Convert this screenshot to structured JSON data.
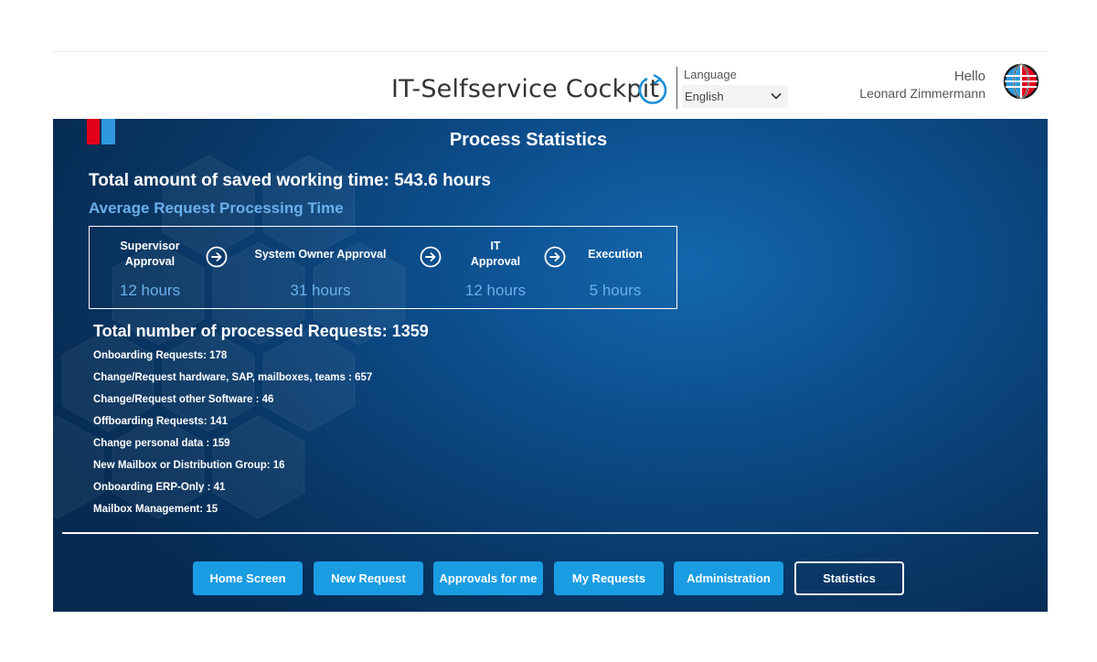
{
  "header": {
    "app_title": "IT-Selfservice Cockpit",
    "language_label": "Language",
    "language_value": "English",
    "greeting_hello": "Hello",
    "user_name": "Leonard Zimmermann"
  },
  "main": {
    "page_title": "Process Statistics",
    "saved_time": "Total amount of saved working time: 543.6 hours",
    "avg_title": "Average Request Processing Time",
    "steps": [
      {
        "label_line1": "Supervisor",
        "label_line2": "Approval",
        "value": "12 hours"
      },
      {
        "label_line1": "System Owner Approval",
        "label_line2": "",
        "value": "31 hours"
      },
      {
        "label_line1": "IT",
        "label_line2": "Approval",
        "value": "12 hours"
      },
      {
        "label_line1": "Execution",
        "label_line2": "",
        "value": "5 hours"
      }
    ],
    "total_requests": "Total number of processed Requests: 1359",
    "requests": [
      "Onboarding Requests: 178",
      "Change/Request hardware, SAP, mailboxes, teams : 657",
      "Change/Request other Software : 46",
      "Offboarding Requests: 141",
      "Change personal data : 159",
      "New Mailbox or Distribution Group: 16",
      "Onboarding ERP-Only : 41",
      "Mailbox Management: 15"
    ]
  },
  "nav": {
    "buttons": [
      {
        "label": "Home Screen",
        "active": false
      },
      {
        "label": "New Request",
        "active": false
      },
      {
        "label": "Approvals for me",
        "active": false
      },
      {
        "label": "My Requests",
        "active": false
      },
      {
        "label": "Administration",
        "active": false
      },
      {
        "label": "Statistics",
        "active": true
      }
    ]
  },
  "colors": {
    "accent": "#1a9ce3",
    "value_blue": "#6ab0ea",
    "brand_red": "#e3001b",
    "brand_blue": "#2e98df",
    "panel_dark": "#0a3e73"
  },
  "icons": {
    "refresh": "refresh-icon",
    "language_dropdown": "chevron-down-icon",
    "user": "globe-icon",
    "step_arrow": "arrow-right-circle-icon"
  }
}
